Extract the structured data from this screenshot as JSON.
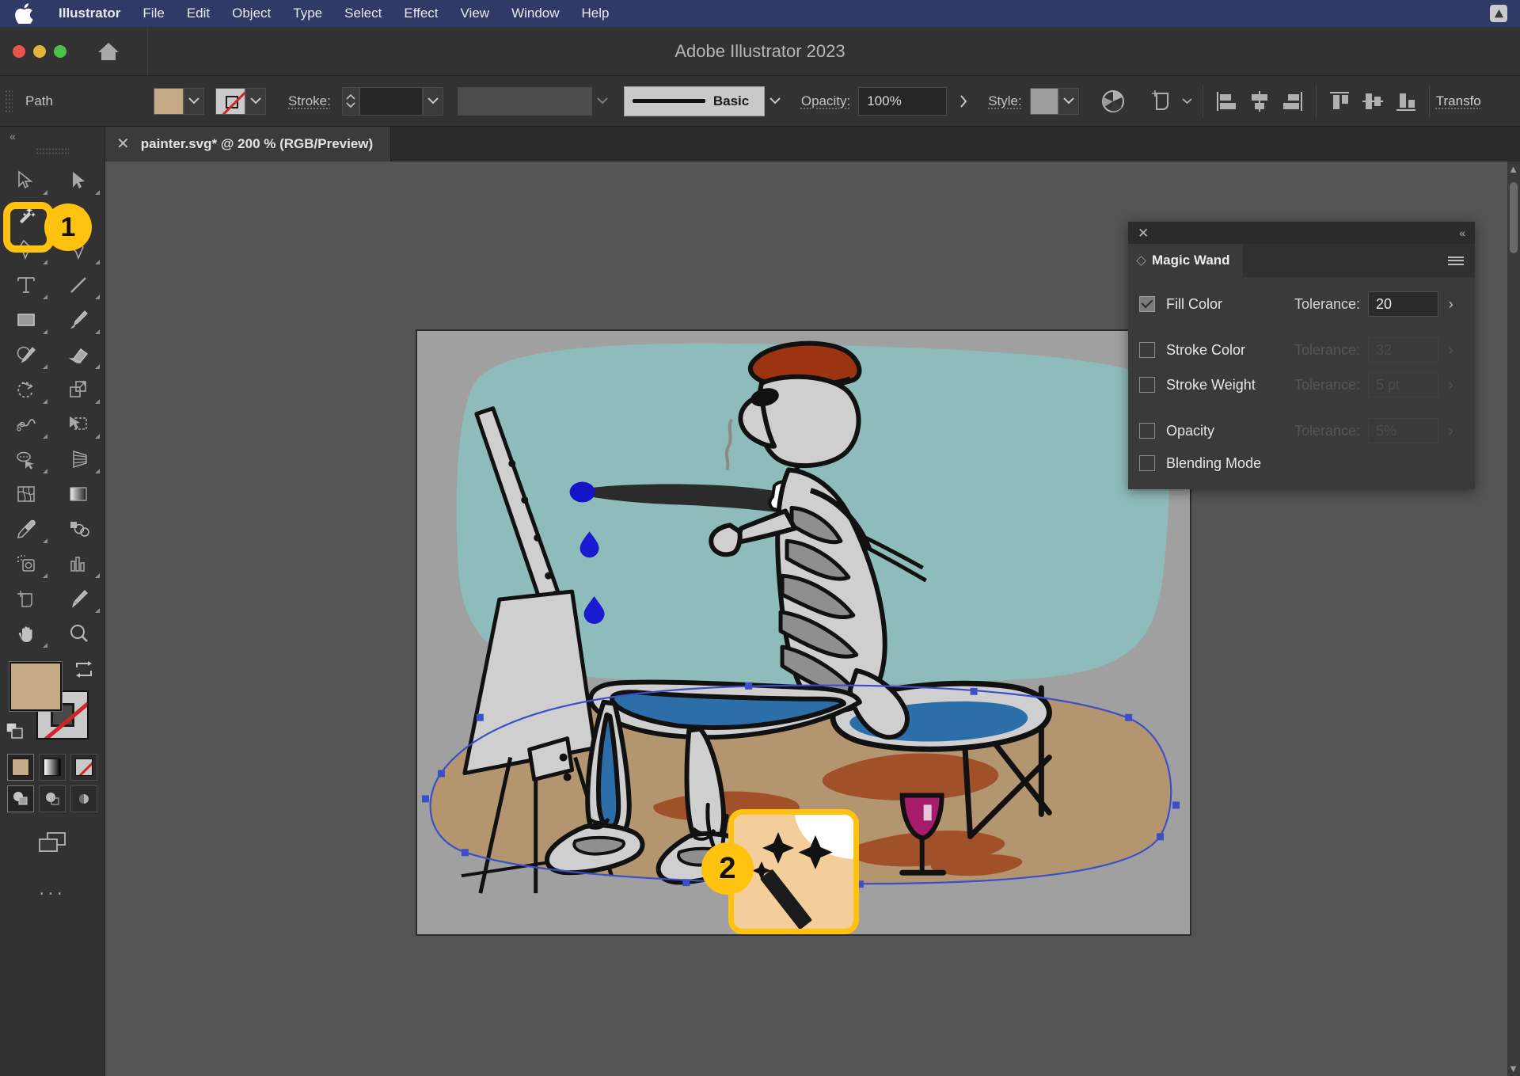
{
  "menubar": {
    "apple_icon": "apple-logo-icon",
    "items": [
      {
        "label": "Illustrator",
        "bold": true
      },
      {
        "label": "File"
      },
      {
        "label": "Edit"
      },
      {
        "label": "Object"
      },
      {
        "label": "Type"
      },
      {
        "label": "Select"
      },
      {
        "label": "Effect"
      },
      {
        "label": "View"
      },
      {
        "label": "Window"
      },
      {
        "label": "Help"
      }
    ],
    "status_icon": "creative-cloud-icon"
  },
  "titlebar": {
    "title": "Adobe Illustrator 2023",
    "close_label": "",
    "minimize_label": "",
    "zoom_label": "",
    "home_icon": "home-icon"
  },
  "controlbar": {
    "object_type": "Path",
    "fill_label": "Fill",
    "fill_color": "#c5ab85",
    "stroke_swatch_label": "None",
    "stroke_label": "Stroke:",
    "stroke_weight_value": "",
    "variable_width_value": "",
    "brush_definition": "Basic",
    "opacity_label": "Opacity:",
    "opacity_value": "100%",
    "style_label": "Style:",
    "style_swatch_color": "#9d9d9d",
    "recolor_icon": "recolor-artwork-icon",
    "transform_artboard_icon": "artboard-transform-icon",
    "align_left_icon": "align-left-icon",
    "align_center_icon": "align-horizontal-center-icon",
    "align_right_icon": "align-right-icon",
    "align_top_icon": "align-top-icon",
    "align_middle_icon": "align-vertical-center-icon",
    "align_bottom_icon": "align-bottom-icon",
    "transform_label": "Transfo"
  },
  "tabbar": {
    "close_icon": "close-tab-icon",
    "document_name": "painter.svg* @ 200 % (RGB/Preview)"
  },
  "toolbar": {
    "collapse_icon": "collapse-panel-icon",
    "tools": [
      {
        "name": "selection-tool",
        "icon": "selection-arrow-icon",
        "has_flyout": true,
        "active": false
      },
      {
        "name": "direct-selection-tool",
        "icon": "direct-selection-arrow-icon",
        "has_flyout": true,
        "active": false
      },
      {
        "name": "magic-wand-tool",
        "icon": "magic-wand-icon",
        "has_flyout": false,
        "active": true
      },
      {
        "name": "lasso-tool",
        "icon": "lasso-icon",
        "has_flyout": false,
        "active": false
      },
      {
        "name": "pen-tool",
        "icon": "pen-icon",
        "has_flyout": true,
        "active": false
      },
      {
        "name": "curvature-tool",
        "icon": "curvature-pen-icon",
        "has_flyout": true,
        "active": false
      },
      {
        "name": "type-tool",
        "icon": "type-t-icon",
        "has_flyout": true,
        "active": false
      },
      {
        "name": "line-segment-tool",
        "icon": "line-segment-icon",
        "has_flyout": true,
        "active": false
      },
      {
        "name": "rectangle-tool",
        "icon": "rectangle-icon",
        "has_flyout": true,
        "active": false
      },
      {
        "name": "paintbrush-tool",
        "icon": "paintbrush-icon",
        "has_flyout": true,
        "active": false
      },
      {
        "name": "shaper-tool",
        "icon": "shaper-pencil-icon",
        "has_flyout": true,
        "active": false
      },
      {
        "name": "eraser-tool",
        "icon": "eraser-icon",
        "has_flyout": true,
        "active": false
      },
      {
        "name": "rotate-tool",
        "icon": "rotate-icon",
        "has_flyout": true,
        "active": false
      },
      {
        "name": "scale-tool",
        "icon": "scale-icon",
        "has_flyout": true,
        "active": false
      },
      {
        "name": "width-tool",
        "icon": "width-warp-icon",
        "has_flyout": true,
        "active": false
      },
      {
        "name": "free-transform-tool",
        "icon": "free-transform-icon",
        "has_flyout": true,
        "active": false
      },
      {
        "name": "shape-builder-tool",
        "icon": "shape-builder-icon",
        "has_flyout": true,
        "active": false
      },
      {
        "name": "perspective-grid-tool",
        "icon": "perspective-grid-icon",
        "has_flyout": true,
        "active": false
      },
      {
        "name": "mesh-tool",
        "icon": "mesh-icon",
        "has_flyout": false,
        "active": false
      },
      {
        "name": "gradient-tool",
        "icon": "gradient-icon",
        "has_flyout": false,
        "active": false
      },
      {
        "name": "eyedropper-tool",
        "icon": "eyedropper-icon",
        "has_flyout": true,
        "active": false
      },
      {
        "name": "blend-tool",
        "icon": "blend-icon",
        "has_flyout": false,
        "active": false
      },
      {
        "name": "symbol-sprayer-tool",
        "icon": "symbol-sprayer-icon",
        "has_flyout": true,
        "active": false
      },
      {
        "name": "column-graph-tool",
        "icon": "column-graph-icon",
        "has_flyout": true,
        "active": false
      },
      {
        "name": "artboard-tool",
        "icon": "artboard-icon",
        "has_flyout": false,
        "active": false
      },
      {
        "name": "slice-tool",
        "icon": "slice-knife-icon",
        "has_flyout": true,
        "active": false
      },
      {
        "name": "hand-tool",
        "icon": "hand-icon",
        "has_flyout": true,
        "active": false
      },
      {
        "name": "zoom-tool",
        "icon": "magnifier-icon",
        "has_flyout": false,
        "active": false
      }
    ],
    "fill_color": "#c5ab85",
    "stroke_color": "none",
    "swap_icon": "swap-fill-stroke-icon",
    "default_icon": "default-fill-stroke-icon",
    "mode_buttons": [
      {
        "name": "color-mode-button",
        "icon": "solid-color-icon",
        "selected": true
      },
      {
        "name": "gradient-mode-button",
        "icon": "gradient-swatch-icon",
        "selected": false
      },
      {
        "name": "none-mode-button",
        "icon": "none-swatch-icon",
        "selected": false
      }
    ],
    "draw_modes": [
      {
        "name": "draw-normal-button",
        "icon": "draw-normal-icon",
        "selected": true
      },
      {
        "name": "draw-behind-button",
        "icon": "draw-behind-icon",
        "selected": false
      },
      {
        "name": "draw-inside-button",
        "icon": "draw-inside-icon",
        "selected": false
      }
    ],
    "screen_mode": {
      "name": "change-screen-mode-button",
      "icon": "screen-mode-icon"
    },
    "more_tools": {
      "name": "edit-toolbar-button",
      "icon": "ellipsis-icon",
      "label": "..."
    }
  },
  "magic_wand_panel": {
    "close_icon": "close-panel-icon",
    "collapse_icon": "collapse-double-arrow-icon",
    "tab_label": "Magic Wand",
    "tab_diamond_icon": "panel-diamond-icon",
    "menu_icon": "panel-menu-icon",
    "rows": [
      {
        "name": "fill-color",
        "label": "Fill Color",
        "checked": true,
        "enabled": true,
        "tolerance_label": "Tolerance:",
        "tolerance_value": "20",
        "caret_icon": "expand-caret-icon"
      },
      {
        "name": "stroke-color",
        "label": "Stroke Color",
        "checked": false,
        "enabled": false,
        "tolerance_label": "Tolerance:",
        "tolerance_value": "32",
        "caret_icon": "expand-caret-icon"
      },
      {
        "name": "stroke-weight",
        "label": "Stroke Weight",
        "checked": false,
        "enabled": false,
        "tolerance_label": "Tolerance:",
        "tolerance_value": "5 pt",
        "caret_icon": "expand-caret-icon"
      },
      {
        "name": "opacity",
        "label": "Opacity",
        "checked": false,
        "enabled": false,
        "tolerance_label": "Tolerance:",
        "tolerance_value": "5%",
        "caret_icon": "expand-caret-icon"
      },
      {
        "name": "blending-mode",
        "label": "Blending Mode",
        "checked": false,
        "enabled": false,
        "tolerance_label": "",
        "tolerance_value": "",
        "caret_icon": ""
      }
    ]
  },
  "callouts": [
    {
      "number": "1",
      "target": "magic-wand-tool",
      "style": "rounded-ring"
    },
    {
      "number": "2",
      "target": "magic-wand-cursor",
      "style": "rounded-card",
      "icon": "magic-wand-cursor-icon"
    }
  ],
  "canvas": {
    "artboard_background": "#a0a0a0",
    "sky_color": "#8fbcba",
    "ground_color": "#b39570",
    "ground_shadow_color": "#a0522d",
    "selection_color": "#3b4fc8",
    "beret_color": "#9c3412",
    "jeans_color": "#2e6fa8",
    "wine_color": "#a61c6b",
    "paint_blue": "#1a1ad0",
    "bone_color": "#cfcfcf"
  },
  "scrollbar": {
    "up_arrow_icon": "scroll-up-icon",
    "down_arrow_icon": "scroll-down-icon"
  }
}
